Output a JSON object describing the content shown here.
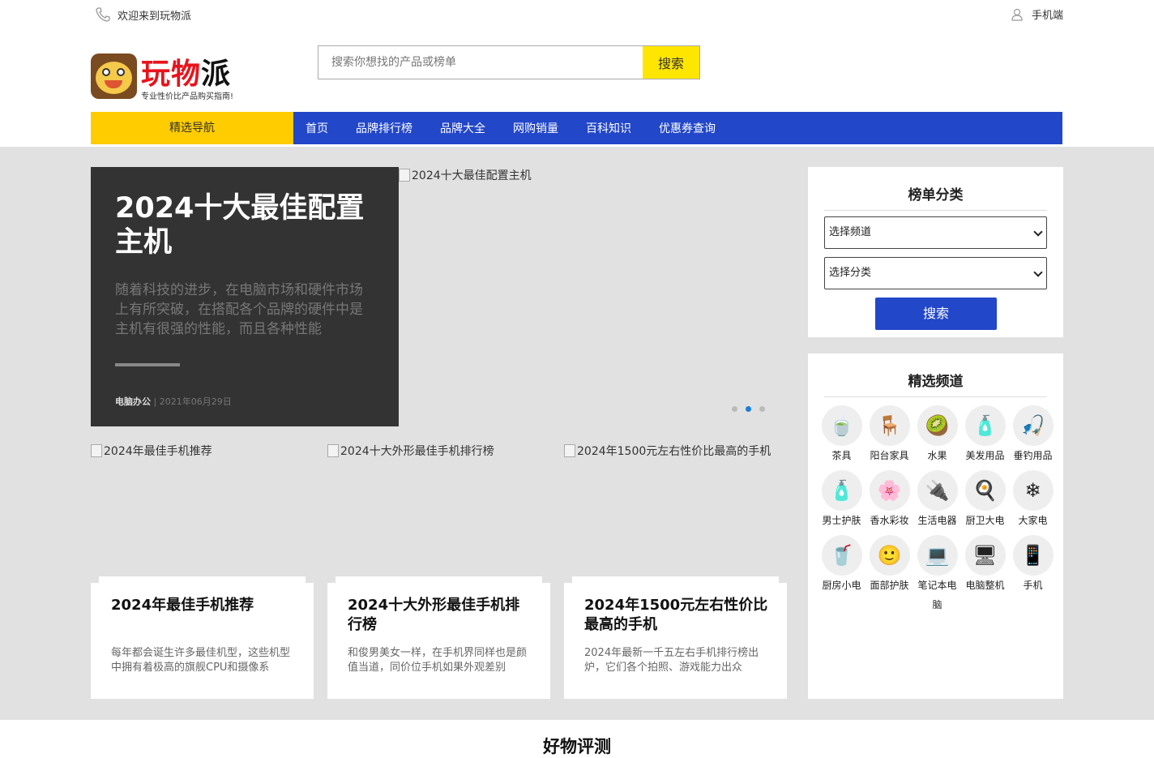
{
  "topbar": {
    "welcome": "欢迎来到玩物派",
    "mobile": "手机端"
  },
  "logo": {
    "name_part1": "玩物",
    "name_part2": "派",
    "slogan": "专业性价比产品购买指南!"
  },
  "search": {
    "placeholder": "搜索你想找的产品或榜单",
    "button": "搜索"
  },
  "nav": {
    "category": "精选导航",
    "items": [
      "首页",
      "品牌排行榜",
      "品牌大全",
      "网购销量",
      "百科知识",
      "优惠券查询"
    ]
  },
  "hero": {
    "title": "2024十大最佳配置主机",
    "summary": "随着科技的进步，在电脑市场和硬件市场上有所突破，在搭配各个品牌的硬件中是主机有很强的性能，而且各种性能",
    "category": "电脑办公",
    "date": "2021年06月29日",
    "image_alt": "2024十大最佳配置主机"
  },
  "cards": [
    {
      "img_alt": "2024年最佳手机推荐",
      "title": "2024年最佳手机推荐",
      "desc": "每年都会诞生许多最佳机型，这些机型中拥有着极高的旗舰CPU和摄像系"
    },
    {
      "img_alt": "2024十大外形最佳手机排行榜",
      "title": "2024十大外形最佳手机排行榜",
      "desc": "和俊男美女一样，在手机界同样也是颜值当道，同价位手机如果外观差别"
    },
    {
      "img_alt": "2024年1500元左右性价比最高的手机",
      "title": "2024年1500元左右性价比最高的手机",
      "desc": "2024年最新一千五左右手机排行榜出炉，它们各个拍照、游戏能力出众"
    }
  ],
  "rank_panel": {
    "title": "榜单分类",
    "select1": "选择频道",
    "select2": "选择分类",
    "button": "搜索"
  },
  "channel_panel": {
    "title": "精选频道",
    "items": [
      {
        "label": "茶具",
        "icon": "tea-set-icon",
        "glyph": "🍵"
      },
      {
        "label": "阳台家具",
        "icon": "patio-furniture-icon",
        "glyph": "🪑"
      },
      {
        "label": "水果",
        "icon": "fruit-icon",
        "glyph": "🥝"
      },
      {
        "label": "美发用品",
        "icon": "hair-product-icon",
        "glyph": "🧴"
      },
      {
        "label": "垂钓用品",
        "icon": "fishing-icon",
        "glyph": "🎣"
      },
      {
        "label": "男士护肤",
        "icon": "mens-skincare-icon",
        "glyph": "🧴"
      },
      {
        "label": "香水彩妆",
        "icon": "perfume-icon",
        "glyph": "🌸"
      },
      {
        "label": "生活电器",
        "icon": "appliance-icon",
        "glyph": "🔌"
      },
      {
        "label": "厨卫大电",
        "icon": "range-hood-icon",
        "glyph": "🍳"
      },
      {
        "label": "大家电",
        "icon": "air-conditioner-icon",
        "glyph": "❄"
      },
      {
        "label": "厨房小电",
        "icon": "juicer-icon",
        "glyph": "🥤"
      },
      {
        "label": "面部护肤",
        "icon": "face-care-icon",
        "glyph": "🙂"
      },
      {
        "label": "笔记本电脑",
        "icon": "laptop-icon",
        "glyph": "💻"
      },
      {
        "label": "电脑整机",
        "icon": "desktop-pc-icon",
        "glyph": "🖥"
      },
      {
        "label": "手机",
        "icon": "phone-icon",
        "glyph": "📱"
      }
    ]
  },
  "section": {
    "title": "好物评测"
  },
  "colors": {
    "nav_blue": "#2347c9",
    "yellow": "#ffcc00",
    "search_yellow": "#ffe600",
    "brand_red": "#e8141c"
  }
}
